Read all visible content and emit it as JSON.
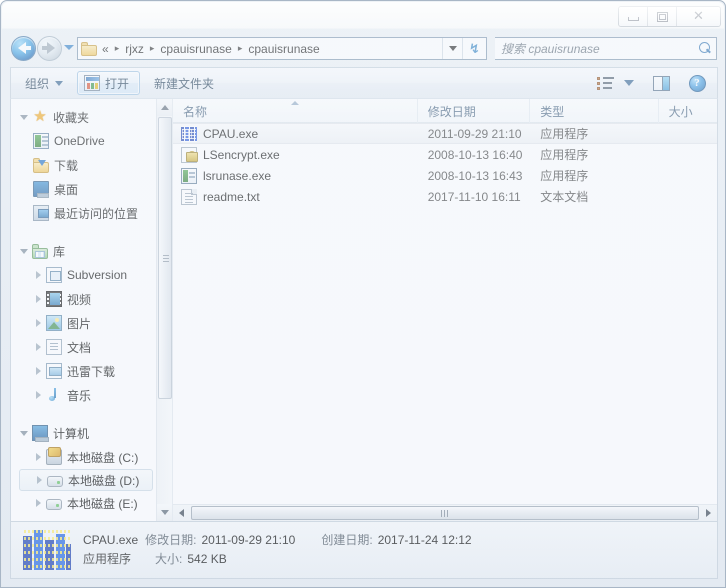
{
  "window": {
    "controls": {
      "minimize": "Minimize",
      "maximize": "Maximize",
      "close": "Close"
    }
  },
  "navigation": {
    "back": "后退",
    "forward": "前进",
    "history": "最近浏览的位置",
    "refresh": "刷新",
    "address_crumbs": [
      "rjxz",
      "cpauisrunase",
      "cpauisrunase"
    ],
    "address_overflow": "«",
    "separator": "▸"
  },
  "search": {
    "placeholder": "搜索 cpauisrunase",
    "icon": "search-icon"
  },
  "toolbar": {
    "organize": "组织",
    "open": "打开",
    "new_folder": "新建文件夹",
    "views": "更改您的视图",
    "preview_pane": "显示预览窗格",
    "help": "?"
  },
  "navpane": {
    "groups": [
      {
        "label": "收藏夹",
        "icon": "star-icon",
        "expanded": true,
        "items": [
          {
            "label": "OneDrive",
            "icon": "onedrive-icon",
            "expandable": false
          },
          {
            "label": "下载",
            "icon": "downloads-folder-icon",
            "expandable": false
          },
          {
            "label": "桌面",
            "icon": "desktop-icon",
            "expandable": false
          },
          {
            "label": "最近访问的位置",
            "icon": "recent-places-icon",
            "expandable": false
          }
        ]
      },
      {
        "label": "库",
        "icon": "library-icon",
        "expanded": true,
        "items": [
          {
            "label": "Subversion",
            "icon": "subversion-icon",
            "expandable": true
          },
          {
            "label": "视频",
            "icon": "video-icon",
            "expandable": true
          },
          {
            "label": "图片",
            "icon": "picture-icon",
            "expandable": true
          },
          {
            "label": "文档",
            "icon": "document-icon",
            "expandable": true
          },
          {
            "label": "迅雷下载",
            "icon": "xunlei-icon",
            "expandable": true
          },
          {
            "label": "音乐",
            "icon": "music-icon",
            "expandable": true
          }
        ]
      },
      {
        "label": "计算机",
        "icon": "computer-icon",
        "expanded": true,
        "items": [
          {
            "label": "本地磁盘 (C:)",
            "icon": "system-drive-icon",
            "expandable": true,
            "selected": false
          },
          {
            "label": "本地磁盘 (D:)",
            "icon": "drive-icon",
            "expandable": true,
            "selected": true
          },
          {
            "label": "本地磁盘 (E:)",
            "icon": "drive-icon",
            "expandable": true,
            "selected": false
          }
        ]
      }
    ]
  },
  "filelist": {
    "columns": [
      {
        "label": "名称",
        "sorted": true
      },
      {
        "label": "修改日期",
        "sorted": false
      },
      {
        "label": "类型",
        "sorted": false
      },
      {
        "label": "大小",
        "sorted": false
      }
    ],
    "rows": [
      {
        "name": "CPAU.exe",
        "date": "2011-09-29 21:10",
        "type": "应用程序",
        "size": "",
        "icon": "cpau-exe-icon",
        "selected": true
      },
      {
        "name": "LSencrypt.exe",
        "date": "2008-10-13 16:40",
        "type": "应用程序",
        "size": "",
        "icon": "lsencrypt-icon",
        "selected": false
      },
      {
        "name": "lsrunase.exe",
        "date": "2008-10-13 16:43",
        "type": "应用程序",
        "size": "",
        "icon": "lsrunase-icon",
        "selected": false
      },
      {
        "name": "readme.txt",
        "date": "2017-11-10 16:11",
        "type": "文本文档",
        "size": "",
        "icon": "text-file-icon",
        "selected": false
      }
    ]
  },
  "details": {
    "filename": "CPAU.exe",
    "modified_label": "修改日期:",
    "modified_value": "2011-09-29 21:10",
    "created_label": "创建日期:",
    "created_value": "2017-11-24 12:12",
    "type": "应用程序",
    "size_label": "大小:",
    "size_value": "542 KB",
    "icon": "cpau-big-icon"
  },
  "colors": {
    "accent": "#2a7ec0",
    "header_text": "#3c5a78",
    "frame": "#c3ced9",
    "selection": "#f0f2f5"
  }
}
